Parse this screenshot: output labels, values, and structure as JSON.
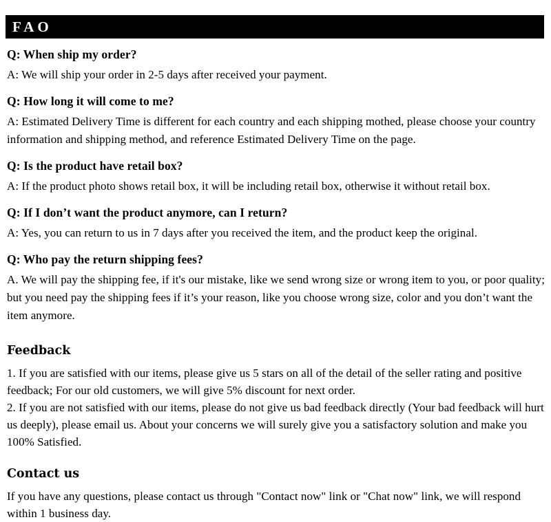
{
  "header": {
    "title": "FAQ",
    "title_display": "FAO",
    "background_color": "#000000",
    "text_color": "#ffffff"
  },
  "faq": {
    "items": [
      {
        "question": "Q: When ship my order?",
        "answer": "A: We will ship your order in 2-5 days after received your payment."
      },
      {
        "question": "Q: How long it will come to me?",
        "answer": "A: Estimated Delivery Time is different for each country and each shipping mothed, please choose your country information and shipping method, and reference Estimated Delivery Time on the page."
      },
      {
        "question": "Q: Is the product have retail box?",
        "answer": "A: If  the product photo shows retail box, it will be including retail box, otherwise it without retail box."
      },
      {
        "question": "Q: If I don’t want the product anymore, can I return?",
        "answer": "A: Yes, you can return to us in 7 days after you received the item, and the product keep the original."
      },
      {
        "question": "Q: Who pay the return shipping fees?",
        "answer": "A.  We will pay the shipping fee, if  it's our mistake, like we send wrong size or wrong item to you, or poor quality; but you need pay the shipping fees if  it’s your reason, like you choose wrong size, color and you don’t want the item anymore."
      }
    ]
  },
  "feedback": {
    "title": "Feedback",
    "line1": "1.  If you are satisfied with our items, please give us 5 stars on all of the detail of the seller rating and positive feedback; For our old customers, we will give 5% discount for next order.",
    "line2": "2.  If you are not satisfied with our items, please do not give us bad feedback directly (Your bad feedback will hurt us deeply), please email us. About your concerns we will surely give you a satisfactory solution and make you 100% Satisfied."
  },
  "contact": {
    "title": "Contact us",
    "body": "If you have any questions, please contact us through \"Contact now\" link or \"Chat now\" link, we will respond within 1 business day."
  }
}
